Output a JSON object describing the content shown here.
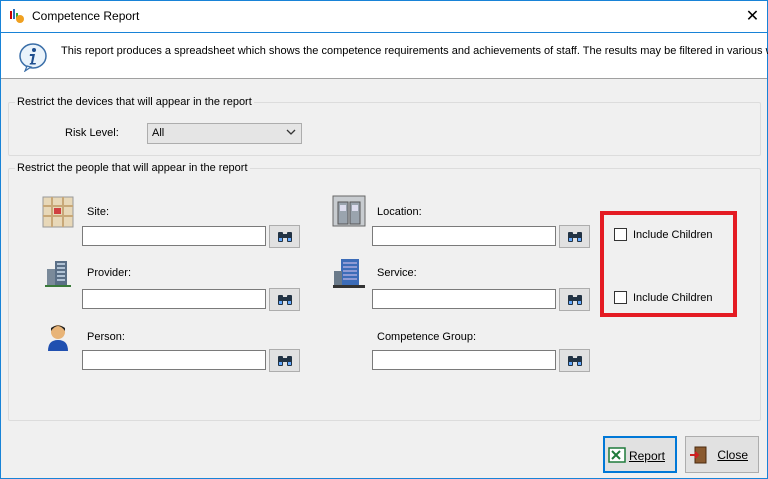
{
  "window": {
    "title": "Competence Report",
    "close_glyph": "✕"
  },
  "info": {
    "text": "This report produces a spreadsheet which shows the competence requirements and achievements of staff. The results may be filtered in various ways"
  },
  "devices_group": {
    "title": "Restrict the devices that will appear in the report",
    "risk_level_label": "Risk Level:",
    "risk_level_value": "All"
  },
  "people_group": {
    "title": "Restrict the people that will appear in the report",
    "site_label": "Site:",
    "location_label": "Location:",
    "provider_label": "Provider:",
    "service_label": "Service:",
    "person_label": "Person:",
    "competence_group_label": "Competence Group:",
    "include_children_1": "Include Children",
    "include_children_2": "Include Children"
  },
  "buttons": {
    "report": "Report",
    "close": "Close"
  },
  "colors": {
    "accent": "#0078d7",
    "highlight": "#e41b23"
  }
}
